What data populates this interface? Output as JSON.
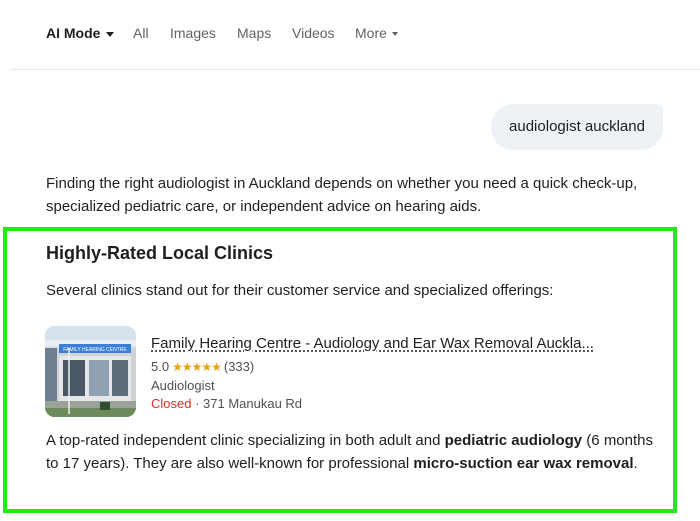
{
  "nav": {
    "tabs": [
      {
        "label": "AI Mode"
      },
      {
        "label": "All"
      },
      {
        "label": "Images"
      },
      {
        "label": "Maps"
      },
      {
        "label": "Videos"
      },
      {
        "label": "More"
      }
    ]
  },
  "query": {
    "text": "audiologist auckland"
  },
  "intro": {
    "text": "Finding the right audiologist in Auckland depends on whether you need a quick check-up, specialized pediatric care, or independent advice on hearing aids."
  },
  "section": {
    "title": "Highly-Rated Local Clinics",
    "description": "Several clinics stand out for their customer service and specialized offerings:"
  },
  "clinic": {
    "name": "Family Hearing Centre - Audiology and Ear Wax Removal Auckla...",
    "rating": "5.0",
    "stars": "★★★★★",
    "reviews": "(333)",
    "category": "Audiologist",
    "status": "Closed",
    "separator": " · ",
    "address": "371 Manukau Rd",
    "sign_text": "FAMILY HEARING CENTRE"
  },
  "body": {
    "p1": "A top-rated independent clinic specializing in both adult and ",
    "b1": "pediatric audiology",
    "p2": " (6 months to 17 years). They are also well-known for professional ",
    "b2": "micro-suction ear wax removal",
    "p3": "."
  },
  "colors": {
    "highlight": "#23e81a",
    "star": "#e7a10f",
    "closed": "#d93025",
    "bubble": "#eef1f6"
  }
}
